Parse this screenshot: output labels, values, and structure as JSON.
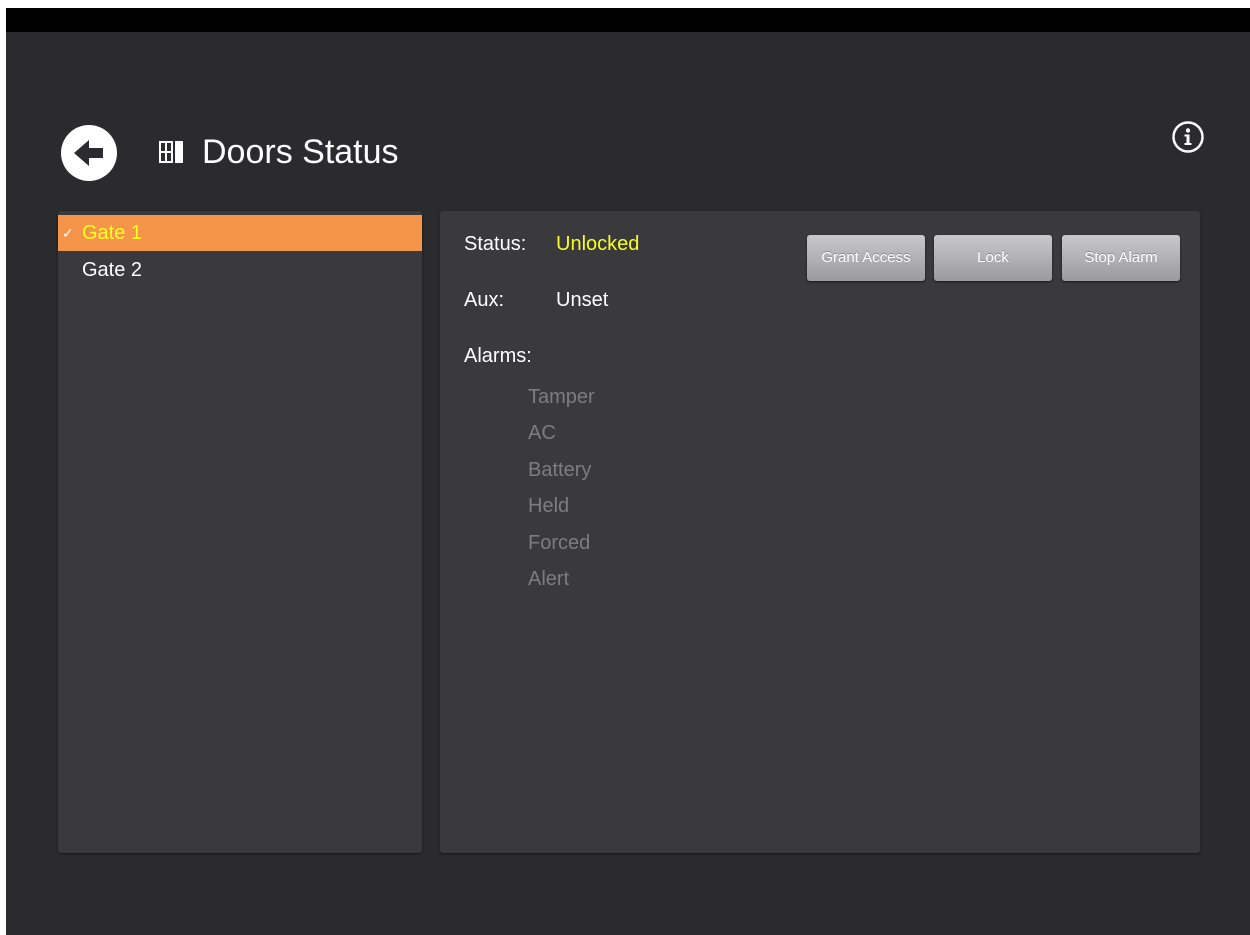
{
  "header": {
    "title": "Doors Status",
    "back_icon": "back-arrow-icon",
    "door_icon": "door-icon",
    "info_icon": "info-icon"
  },
  "gates": [
    {
      "label": "Gate 1",
      "selected": true,
      "check": "✓"
    },
    {
      "label": "Gate 2",
      "selected": false,
      "check": ""
    }
  ],
  "details": {
    "status_label": "Status:",
    "status_value": "Unlocked",
    "aux_label": "Aux:",
    "aux_value": "Unset",
    "alarms_label": "Alarms:",
    "alarms": [
      "Tamper",
      "AC",
      "Battery",
      "Held",
      "Forced",
      "Alert"
    ]
  },
  "actions": {
    "grant_access": "Grant Access",
    "lock": "Lock",
    "stop_alarm": "Stop Alarm"
  },
  "colors": {
    "background": "#2b2b2d",
    "panel": "#3a3a3c",
    "selected_row": "#f5954a",
    "highlight_text": "#f7ff22",
    "inactive_alarm": "#7d7d7f"
  }
}
